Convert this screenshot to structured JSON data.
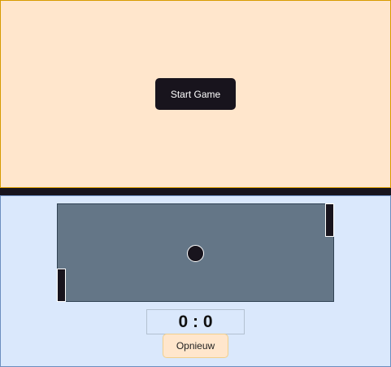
{
  "start_panel": {
    "start_button_label": "Start Game"
  },
  "game": {
    "score": "0 : 0",
    "restart_button_label": "Opnieuw"
  },
  "colors": {
    "top_bg": "#ffe6cc",
    "bottom_bg": "#dae8fc",
    "field": "#647687",
    "dark": "#18141d"
  }
}
